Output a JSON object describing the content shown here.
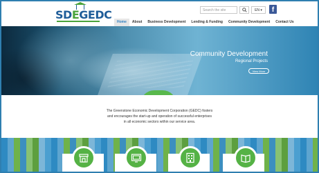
{
  "header": {
    "logo_text_a": "SD",
    "logo_text_e": "E",
    "logo_text_b": "GEDC",
    "search_placeholder": "Search the site",
    "language": "EN ▾",
    "facebook": "f"
  },
  "nav": {
    "items": [
      {
        "label": "Home",
        "active": true
      },
      {
        "label": "About"
      },
      {
        "label": "Business Development"
      },
      {
        "label": "Lending & Funding"
      },
      {
        "label": "Community Development"
      },
      {
        "label": "Contact Us"
      }
    ]
  },
  "hero": {
    "title": "Community Development",
    "subtitle": "Regional Projects",
    "button": "View More"
  },
  "intro": {
    "line1": "The Greenstone Economic Development Corporation (GEDC) fosters",
    "line2": "and encourages the start-up and operation of successful enterprises",
    "line3": "in all economic sectors within our service area."
  },
  "services": {
    "icons": [
      "store-icon",
      "monitor-icon",
      "building-icon",
      "book-icon"
    ]
  },
  "colors": {
    "brand_blue": "#1f5d99",
    "brand_green": "#4aa33a",
    "accent_green": "#55b245",
    "facebook_blue": "#3b5998"
  }
}
